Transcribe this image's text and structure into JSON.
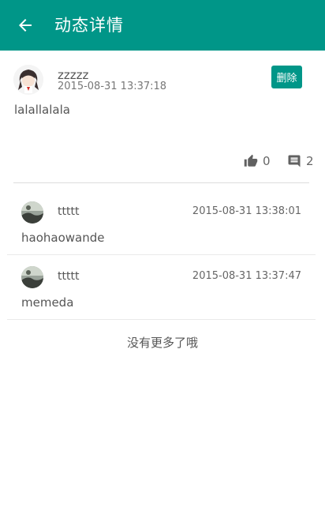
{
  "header": {
    "title": "动态详情"
  },
  "post": {
    "username": "zzzzz",
    "time": "2015-08-31 13:37:18",
    "delete_label": "删除",
    "content": "lalallalala",
    "likes": "0",
    "comments": "2"
  },
  "comments": [
    {
      "username": "ttttt",
      "time": "2015-08-31 13:38:01",
      "text": "haohaowande"
    },
    {
      "username": "ttttt",
      "time": "2015-08-31 13:37:47",
      "text": "memeda"
    }
  ],
  "footer": {
    "no_more": "没有更多了哦"
  },
  "colors": {
    "accent": "#009688"
  }
}
